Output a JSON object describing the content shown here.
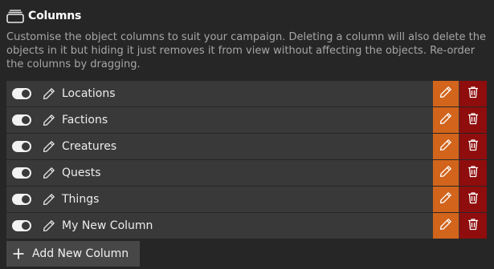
{
  "header": {
    "title": "Columns",
    "icon": "stacked-window-icon"
  },
  "description": "Customise the object columns to suit your campaign. Deleting a column will also delete the objects in it but hiding it just removes it from view without affecting the objects. Re-order the columns by dragging.",
  "columns": [
    {
      "label": "Locations",
      "visible": true
    },
    {
      "label": "Factions",
      "visible": true
    },
    {
      "label": "Creatures",
      "visible": true
    },
    {
      "label": "Quests",
      "visible": true
    },
    {
      "label": "Things",
      "visible": true
    },
    {
      "label": "My New Column",
      "visible": true
    }
  ],
  "add_button": {
    "label": "Add New Column",
    "icon": "plus-icon"
  },
  "colors": {
    "background": "#262626",
    "row": "#393939",
    "edit": "#d2641b",
    "delete": "#8f0d0d",
    "add_button": "#474747"
  }
}
